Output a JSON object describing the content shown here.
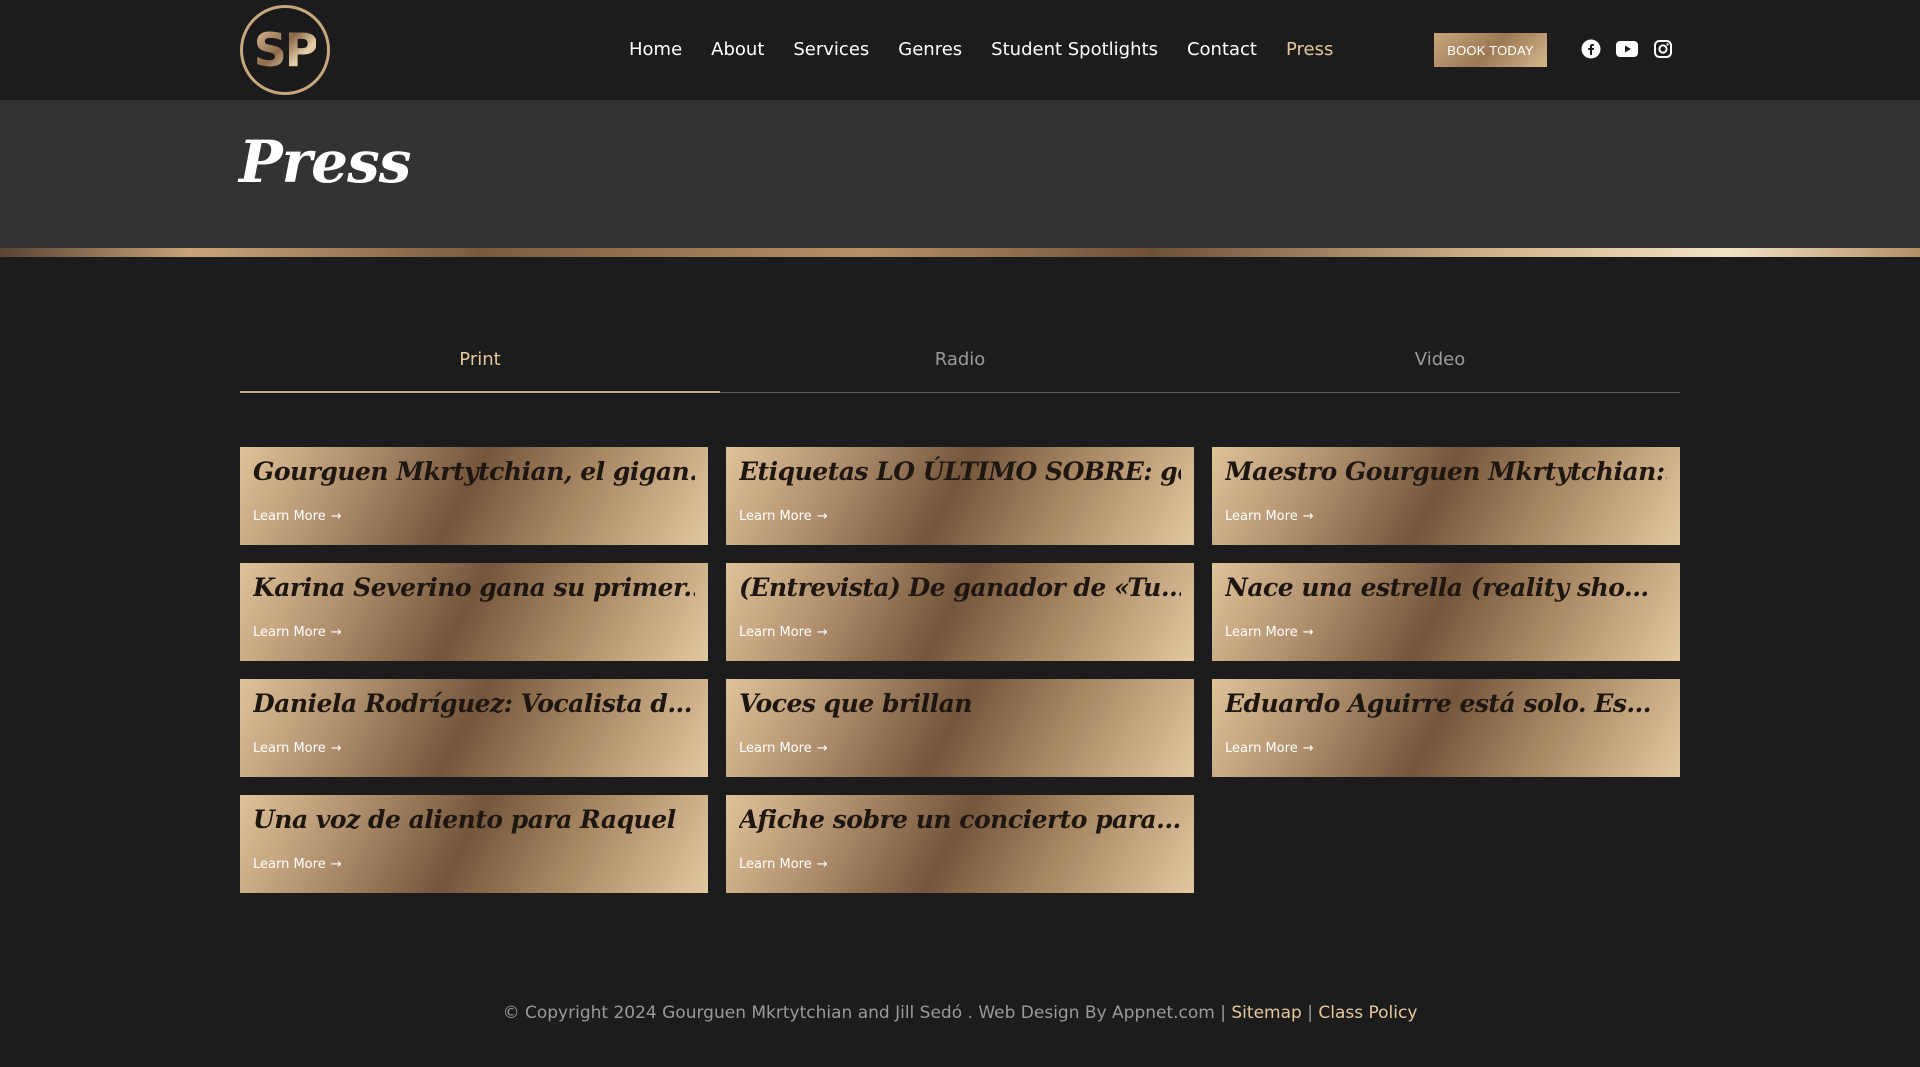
{
  "header": {
    "logo_text": "SP",
    "nav": [
      "Home",
      "About",
      "Services",
      "Genres",
      "Student Spotlights",
      "Contact",
      "Press"
    ],
    "active_nav": "Press",
    "book_button": "BOOK TODAY",
    "social_icons": [
      "facebook-icon",
      "youtube-icon",
      "instagram-icon"
    ]
  },
  "page": {
    "title": "Press"
  },
  "tabs": [
    {
      "label": "Print",
      "active": true
    },
    {
      "label": "Radio",
      "active": false
    },
    {
      "label": "Video",
      "active": false
    }
  ],
  "cards": [
    {
      "title": "Gourguen Mkrtytchian, el gigan...",
      "link": "Learn More"
    },
    {
      "title": "Etiquetas LO ÚLTIMO SOBRE: gou...",
      "link": "Learn More"
    },
    {
      "title": "Maestro Gourguen Mkrtytchian:...",
      "link": "Learn More"
    },
    {
      "title": "Karina Severino gana su primer...",
      "link": "Learn More"
    },
    {
      "title": "(Entrevista) De ganador de «Tu...",
      "link": "Learn More"
    },
    {
      "title": "Nace una estrella (reality sho...",
      "link": "Learn More"
    },
    {
      "title": "Daniela Rodríguez: Vocalista d...",
      "link": "Learn More"
    },
    {
      "title": "Voces que brillan",
      "link": "Learn More"
    },
    {
      "title": "Eduardo Aguirre está solo. Es...",
      "link": "Learn More"
    },
    {
      "title": "Una voz de aliento para Raquel",
      "link": "Learn More"
    },
    {
      "title": "Afiche sobre un concierto para...",
      "link": "Learn More"
    }
  ],
  "footer": {
    "copyright": "© Copyright 2024 Gourguen Mkrtytchian and Jill Sedó . Web Design By Appnet.com |",
    "sitemap": "Sitemap",
    "separator": "|",
    "class_policy": "Class Policy"
  },
  "colors": {
    "accent": "#e6c79c",
    "background": "#1c1c1c",
    "band": "#333333"
  }
}
